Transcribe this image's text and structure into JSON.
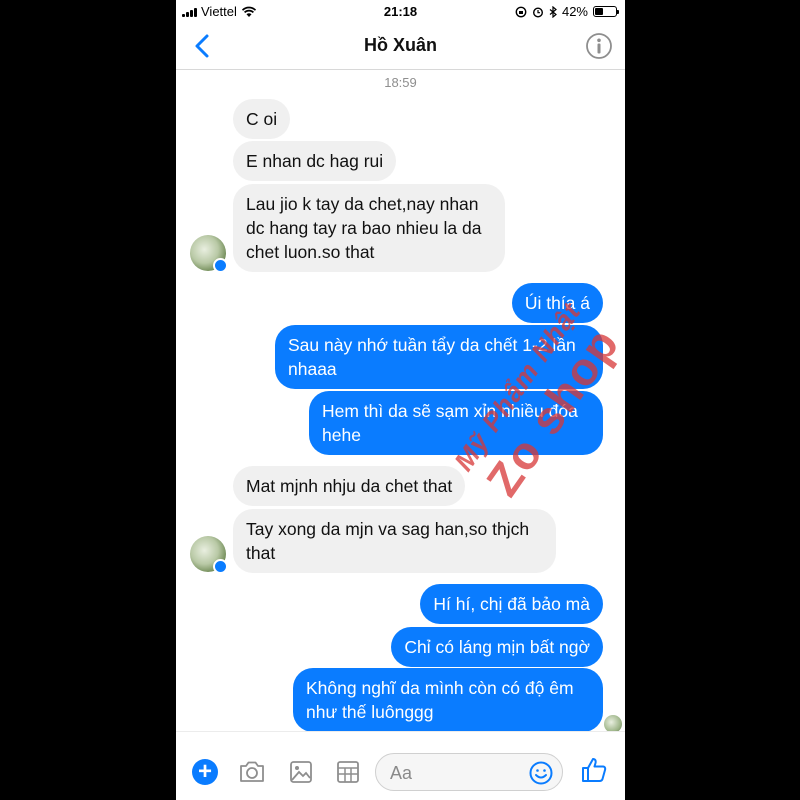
{
  "status_bar": {
    "carrier": "Viettel",
    "time": "21:18",
    "battery_percent": "42%",
    "battery_level": 0.42
  },
  "nav": {
    "back_icon": "chevron-left-icon",
    "title": "Hồ Xuân",
    "info_icon": "info-icon"
  },
  "timestamp": "18:59",
  "messages": {
    "m1": "C oi",
    "m2": "E nhan dc hag rui",
    "m3": "Lau jio k tay da chet,nay nhan dc hang tay ra bao nhieu la da chet luon.so that",
    "m4": "Úi thía á",
    "m5": "Sau này nhớ tuần tẩy da chết 1-2 lần nhaaa",
    "m6": "Hem thì da sẽ sạm xỉn nhiều đóa hehe",
    "m7": "Mat mjnh nhju da chet that",
    "m8": "Tay xong da mjn va sag han,so thjch that",
    "m9": "Hí hí, chị đã bảo mà",
    "m10": "Chỉ có láng mịn bất ngờ",
    "m11": "Không nghĩ da mình còn có độ êm như thế luônggg"
  },
  "watermark": {
    "line1": "Mỹ Phẩm Nhật",
    "line2": "Zo shop"
  },
  "composer": {
    "placeholder": "Aa",
    "icons": [
      "plus-icon",
      "camera-icon",
      "photo-icon",
      "grid-icon",
      "emoji-icon",
      "thumbs-up-icon"
    ]
  },
  "colors": {
    "accent": "#0a7cff",
    "incoming_bubble": "#f0f0f0",
    "watermark": "#d73737"
  }
}
